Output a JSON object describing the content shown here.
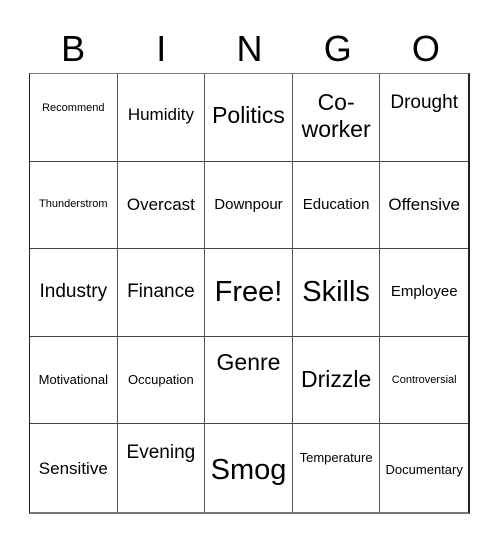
{
  "header": {
    "letters": [
      "B",
      "I",
      "N",
      "G",
      "O"
    ]
  },
  "cells": [
    [
      "Recommend",
      "Humidity",
      "Politics",
      "Co-worker",
      "Drought"
    ],
    [
      "Thunderstrom",
      "Overcast",
      "Downpour",
      "Education",
      "Offensive"
    ],
    [
      "Industry",
      "Finance",
      "Free!",
      "Skills",
      "Employee"
    ],
    [
      "Motivational",
      "Occupation",
      "Genre",
      "Drizzle",
      "Controversial"
    ],
    [
      "Sensitive",
      "Evening",
      "Smog",
      "Temperature",
      "Documentary"
    ]
  ]
}
